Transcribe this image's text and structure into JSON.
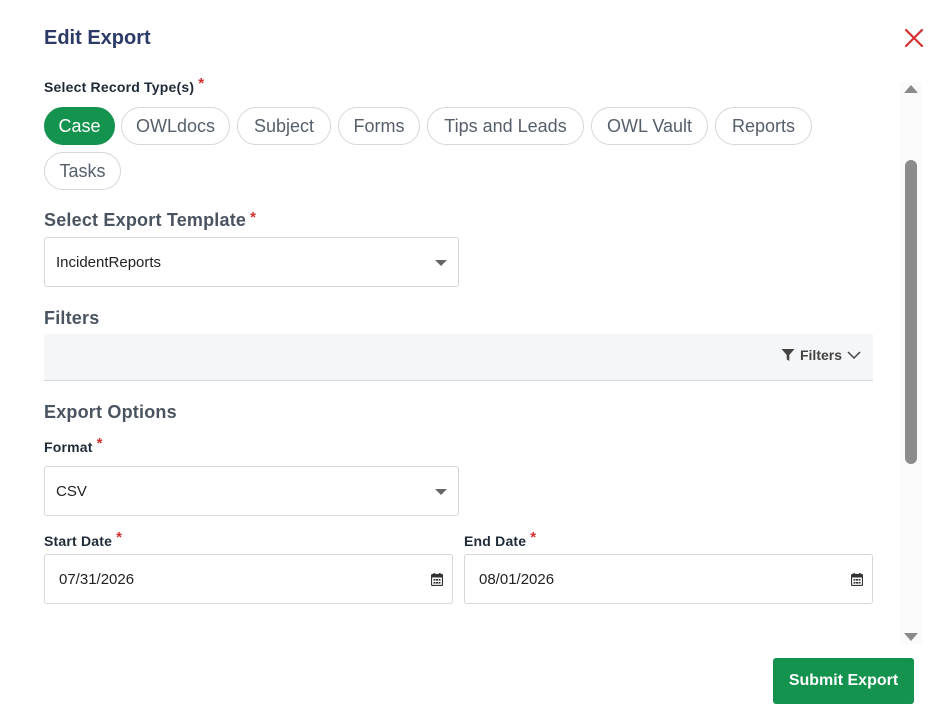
{
  "dialog": {
    "title": "Edit Export"
  },
  "record_types": {
    "label": "Select Record Type(s)",
    "required_mark": "*",
    "chips": [
      {
        "label": "Case",
        "selected": true
      },
      {
        "label": "OWLdocs",
        "selected": false
      },
      {
        "label": "Subject",
        "selected": false
      },
      {
        "label": "Forms",
        "selected": false
      },
      {
        "label": "Tips and Leads",
        "selected": false
      },
      {
        "label": "OWL Vault",
        "selected": false
      },
      {
        "label": "Reports",
        "selected": false
      },
      {
        "label": "Tasks",
        "selected": false
      }
    ]
  },
  "template": {
    "label": "Select Export Template",
    "required_mark": "*",
    "value": "IncidentReports"
  },
  "filters": {
    "heading": "Filters",
    "button_label": "Filters"
  },
  "export_options": {
    "heading": "Export Options",
    "format": {
      "label": "Format",
      "required_mark": "*",
      "value": "CSV"
    },
    "start_date": {
      "label": "Start Date",
      "required_mark": "*",
      "value": "07/31/2026"
    },
    "end_date": {
      "label": "End Date",
      "required_mark": "*",
      "value": "08/01/2026"
    }
  },
  "actions": {
    "submit_label": "Submit Export"
  },
  "colors": {
    "accent": "#14934f",
    "title": "#2b3a67",
    "required": "#d32f2f",
    "close": "#d32f2f"
  },
  "icons": {
    "close": "close-icon",
    "filter": "filter-icon",
    "chevron": "chevron-down-icon",
    "calendar": "calendar-icon",
    "dropdown": "caret-down-icon"
  }
}
